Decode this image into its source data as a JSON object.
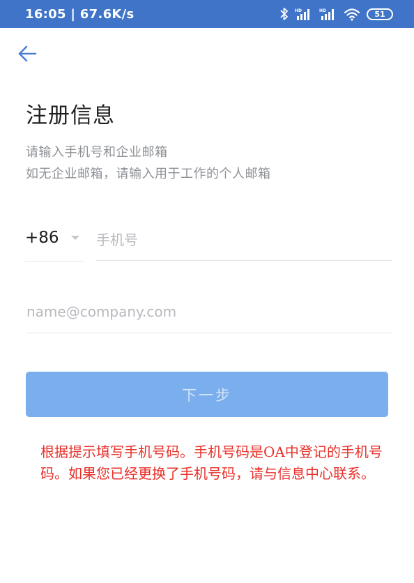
{
  "status_bar": {
    "time_speed": "16:05 | 67.6K/s",
    "icons": [
      "bluetooth-icon",
      "signal-hd-icon",
      "signal-hd-icon",
      "wifi-icon",
      "battery-icon"
    ],
    "battery": "51",
    "background": "#3f74c8"
  },
  "nav": {
    "back_icon": "arrow-left-icon",
    "icon_color": "#4a7fd0"
  },
  "page": {
    "title": "注册信息",
    "subtitle_line1": "请输入手机号和企业邮箱",
    "subtitle_line2": "如无企业邮箱，请输入用于工作的个人邮箱"
  },
  "form": {
    "country_code": "+86",
    "phone_placeholder": "手机号",
    "email_placeholder": "name@company.com",
    "next_button": "下一步",
    "button_color": "#7aaeed"
  },
  "annotation": {
    "text": "根据提示填写手机号码。手机号码是OA中登记的手机号码。如果您已经更换了手机号码，请与信息中心联系。",
    "color": "#e8302a"
  }
}
